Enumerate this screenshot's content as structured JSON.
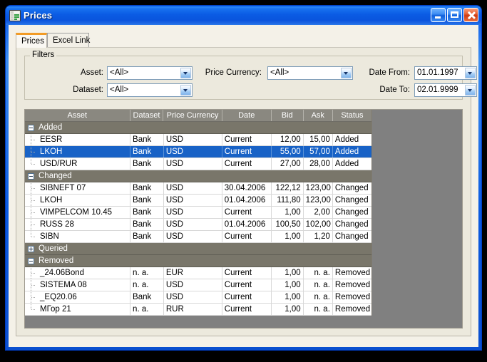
{
  "window": {
    "title": "Prices",
    "icon": "spreadsheet-icon",
    "buttons": {
      "minimize": "Minimize",
      "maximize": "Maximize",
      "close": "Close"
    },
    "accent_color": "#0a54dd",
    "close_color": "#cf3b13"
  },
  "tabs": [
    {
      "label": "Prices",
      "active": true
    },
    {
      "label": "Excel Link",
      "active": false
    }
  ],
  "filters": {
    "legend": "Filters",
    "fields": [
      {
        "label": "Asset:",
        "value": "<All>"
      },
      {
        "label": "Dataset:",
        "value": "<All>"
      },
      {
        "label": "Price Currency:",
        "value": "<All>"
      },
      {
        "label": "Date From:",
        "value": "01.01.1997"
      },
      {
        "label": "Date To:",
        "value": "02.01.9999"
      }
    ]
  },
  "grid": {
    "columns": [
      "Asset",
      "Dataset",
      "Price Currency",
      "Date",
      "Bid",
      "Ask",
      "Status"
    ],
    "groups": [
      {
        "label": "Added",
        "expanded": true,
        "rows": [
          {
            "asset": "EESR",
            "dataset": "Bank",
            "currency": "USD",
            "date": "Current",
            "bid": "12,00",
            "ask": "15,00",
            "status": "Added",
            "selected": false
          },
          {
            "asset": "LKOH",
            "dataset": "Bank",
            "currency": "USD",
            "date": "Current",
            "bid": "55,00",
            "ask": "57,00",
            "status": "Added",
            "selected": true
          },
          {
            "asset": "USD/RUR",
            "dataset": "Bank",
            "currency": "USD",
            "date": "Current",
            "bid": "27,00",
            "ask": "28,00",
            "status": "Added",
            "selected": false
          }
        ]
      },
      {
        "label": "Changed",
        "expanded": true,
        "rows": [
          {
            "asset": "SIBNEFT 07",
            "dataset": "Bank",
            "currency": "USD",
            "date": "30.04.2006",
            "bid": "122,12",
            "ask": "123,00",
            "status": "Changed",
            "selected": false
          },
          {
            "asset": "LKOH",
            "dataset": "Bank",
            "currency": "USD",
            "date": "01.04.2006",
            "bid": "111,80",
            "ask": "123,00",
            "status": "Changed",
            "selected": false
          },
          {
            "asset": "VIMPELCOM 10.45",
            "dataset": "Bank",
            "currency": "USD",
            "date": "Current",
            "bid": "1,00",
            "ask": "2,00",
            "status": "Changed",
            "selected": false
          },
          {
            "asset": "RUSS 28",
            "dataset": "Bank",
            "currency": "USD",
            "date": "01.04.2006",
            "bid": "100,50",
            "ask": "102,00",
            "status": "Changed",
            "selected": false
          },
          {
            "asset": "SIBN",
            "dataset": "Bank",
            "currency": "USD",
            "date": "Current",
            "bid": "1,00",
            "ask": "1,20",
            "status": "Changed",
            "selected": false
          }
        ]
      },
      {
        "label": "Queried",
        "expanded": false,
        "rows": []
      },
      {
        "label": "Removed",
        "expanded": true,
        "rows": [
          {
            "asset": "_24.06Bond",
            "dataset": "n. a.",
            "currency": "EUR",
            "date": "Current",
            "bid": "1,00",
            "ask": "n. a.",
            "status": "Removed",
            "selected": false
          },
          {
            "asset": "SISTEMA 08",
            "dataset": "n. a.",
            "currency": "USD",
            "date": "Current",
            "bid": "1,00",
            "ask": "n. a.",
            "status": "Removed",
            "selected": false
          },
          {
            "asset": "_EQ20.06",
            "dataset": "Bank",
            "currency": "USD",
            "date": "Current",
            "bid": "1,00",
            "ask": "n. a.",
            "status": "Removed",
            "selected": false
          },
          {
            "asset": "МГор 21",
            "dataset": "n. a.",
            "currency": "RUR",
            "date": "Current",
            "bid": "1,00",
            "ask": "n. a.",
            "status": "Removed",
            "selected": false
          }
        ]
      }
    ],
    "selection_color": "#1862c6",
    "header_color": "#8a8880",
    "group_color": "#79766a"
  }
}
